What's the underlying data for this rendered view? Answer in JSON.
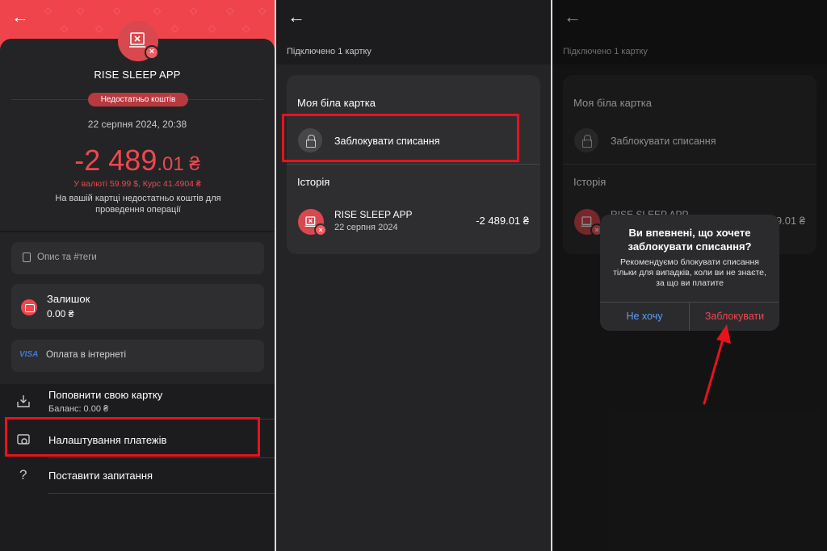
{
  "panel1": {
    "merchant_name": "RISE SLEEP APP",
    "status_badge": "Недостатньо коштів",
    "datetime": "22 серпня 2024, 20:38",
    "amount_main": "-2 489",
    "amount_fraction": ".01 ₴",
    "fx_line": "У валюті 59.99 $, Курс 41.4904 ₴",
    "note": "На вашій картці недостатньо коштів для проведення операції",
    "description_placeholder": "Опис та #теги",
    "balance_label": "Залишок",
    "balance_value": "0.00 ₴",
    "visa_logo": "VISA",
    "payment_type": "Оплата в інтернеті",
    "menu": [
      {
        "title": "Поповнити свою картку",
        "subtitle": "Баланс: 0.00 ₴"
      },
      {
        "title": "Налаштування платежів"
      },
      {
        "title": "Поставити запитання"
      }
    ],
    "question_icon": "?"
  },
  "panel2": {
    "connected": "Підключено 1 картку",
    "card_title": "Моя біла картка",
    "block_action": "Заблокувати списання",
    "history_title": "Історія",
    "tx_name": "RISE SLEEP APP",
    "tx_date": "22 серпня 2024",
    "tx_amount": "-2 489.01 ₴"
  },
  "panel3": {
    "connected": "Підключено 1 картку",
    "card_title": "Моя біла картка",
    "block_action": "Заблокувати списання",
    "history_title": "Історія",
    "tx_name": "RISE SLEEP APP",
    "tx_amount": "-2 489.01 ₴",
    "dialog": {
      "title": "Ви впевнені, що хочете заблокувати списання?",
      "message": "Рекомендуємо блокувати списання тільки для випадків, коли ви не знаєте, за що ви платите",
      "cancel": "Не хочу",
      "confirm": "Заблокувати"
    }
  },
  "colors": {
    "accent": "#f0474f",
    "link": "#5aa0ff",
    "highlight": "#e8121c"
  },
  "icons": {
    "back": "arrow-left-icon",
    "lock": "lock-icon",
    "wallet": "wallet-icon"
  }
}
